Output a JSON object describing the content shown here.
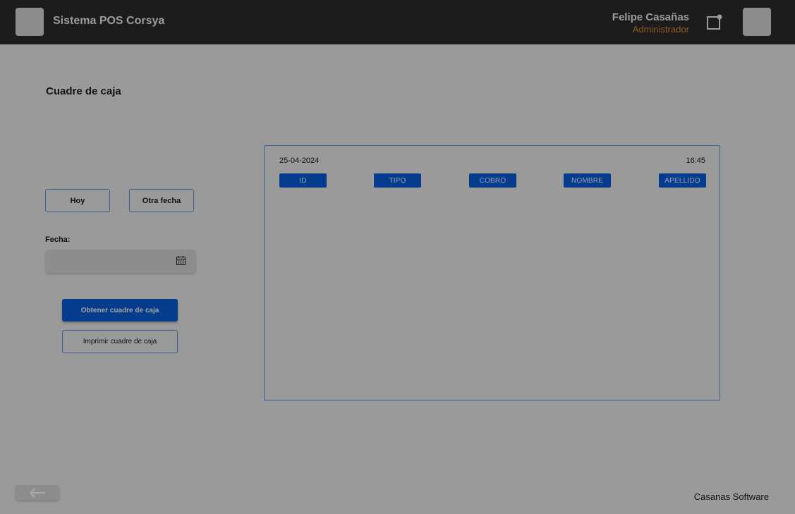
{
  "header": {
    "app_title": "Sistema POS Corsya",
    "user_name": "Felipe Casañas",
    "user_role": "Administrador",
    "icons": [
      "logo",
      "notification-icon",
      "avatar"
    ]
  },
  "page": {
    "title": "Cuadre de caja"
  },
  "filters": {
    "today_label": "Hoy",
    "other_date_label": "Otra fecha",
    "date_label": "Fecha:",
    "date_value": "",
    "date_icon": "calendar-icon"
  },
  "actions": {
    "get_label": "Obtener cuadre de caja",
    "print_label": "Imprimir cuadre de caja"
  },
  "panel": {
    "date": "25-04-2024",
    "time": "16:45",
    "columns": [
      "ID",
      "TIPO",
      "COBRO",
      "NOMBRE",
      "APELLIDO"
    ]
  },
  "footer": {
    "brand": "Casanas Software",
    "back_icon": "arrow-left-icon"
  },
  "colors": {
    "topbar": "#1c1c1c",
    "primary": "#063c8e",
    "role": "#8e5c22",
    "overlay_bg": "#9a9a9a"
  }
}
